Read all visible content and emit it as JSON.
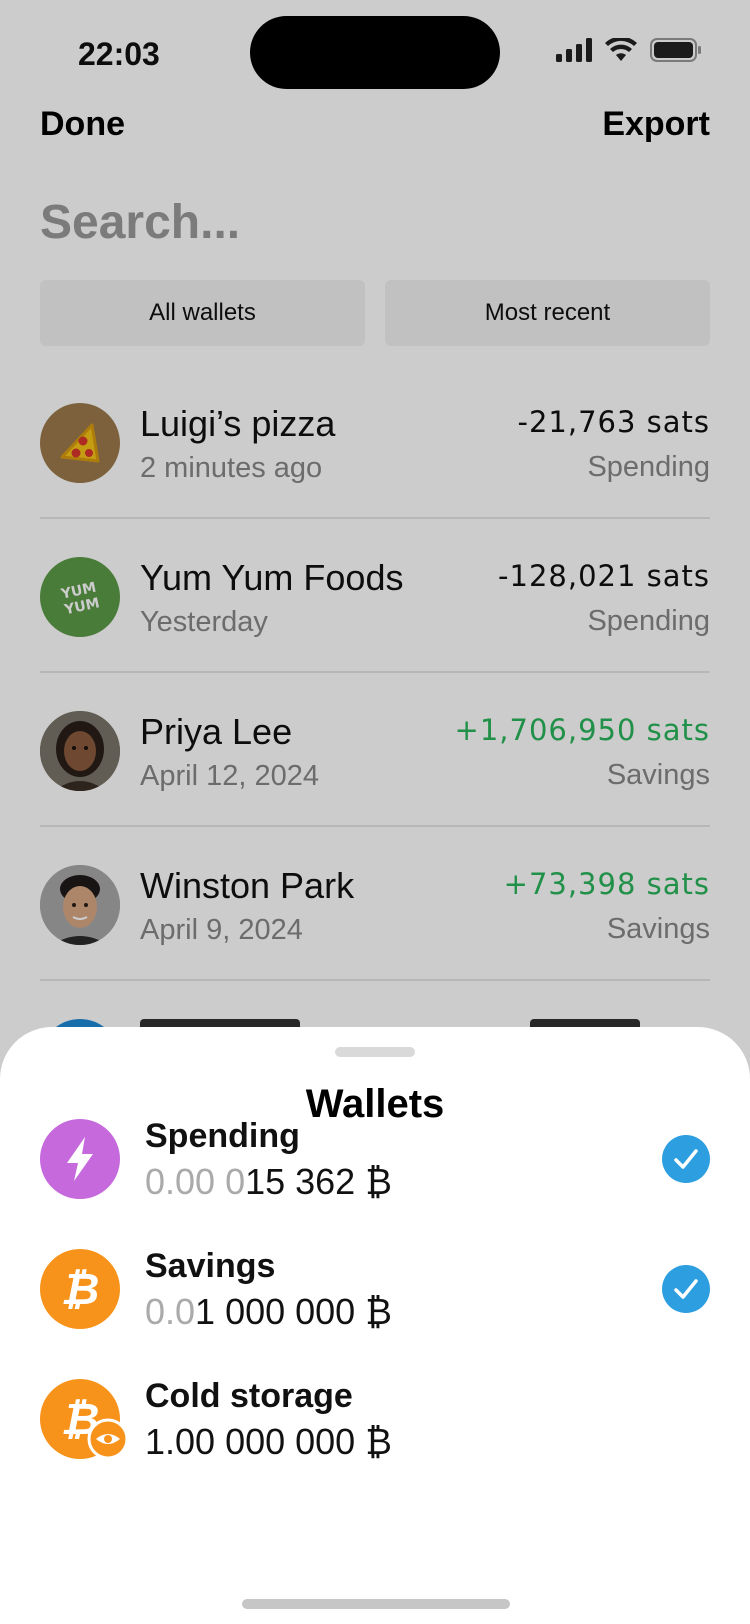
{
  "status_bar": {
    "time": "22:03"
  },
  "nav": {
    "done_label": "Done",
    "export_label": "Export"
  },
  "search": {
    "placeholder": "Search..."
  },
  "filters": {
    "wallets_label": "All wallets",
    "sort_label": "Most recent"
  },
  "transactions": [
    {
      "name": "Luigi’s pizza",
      "date": "2 minutes ago",
      "amount": "-21,763 sats",
      "wallet": "Spending",
      "direction": "out",
      "avatar": "pizza-icon"
    },
    {
      "name": "Yum Yum Foods",
      "date": "Yesterday",
      "amount": "-128,021 sats",
      "wallet": "Spending",
      "direction": "out",
      "avatar": "yum-yum-logo",
      "logo_text": "YUM YUM"
    },
    {
      "name": "Priya Lee",
      "date": "April 12, 2024",
      "amount": "+1,706,950 sats",
      "wallet": "Savings",
      "direction": "in",
      "avatar": "person-photo"
    },
    {
      "name": "Winston Park",
      "date": "April 9, 2024",
      "amount": "+73,398 sats",
      "wallet": "Savings",
      "direction": "in",
      "avatar": "person-photo"
    }
  ],
  "sheet": {
    "title": "Wallets",
    "wallets": [
      {
        "name": "Spending",
        "balance_dim": "0.00 0",
        "balance": "15 362 ₿",
        "selected": true,
        "icon": "lightning-icon",
        "color": "#c569dc"
      },
      {
        "name": "Savings",
        "balance_dim": "0.0",
        "balance": "1 000 000 ₿",
        "selected": true,
        "icon": "bitcoin-icon",
        "color": "#f7931a"
      },
      {
        "name": "Cold storage",
        "balance_dim": "",
        "balance": "1.00 000 000 ₿",
        "selected": false,
        "icon": "bitcoin-watch-icon",
        "color": "#f7931a"
      }
    ]
  },
  "colors": {
    "positive": "#2ab45a",
    "check": "#2d9ee0",
    "dim_overlay": "rgba(0,0,0,0.2)"
  }
}
